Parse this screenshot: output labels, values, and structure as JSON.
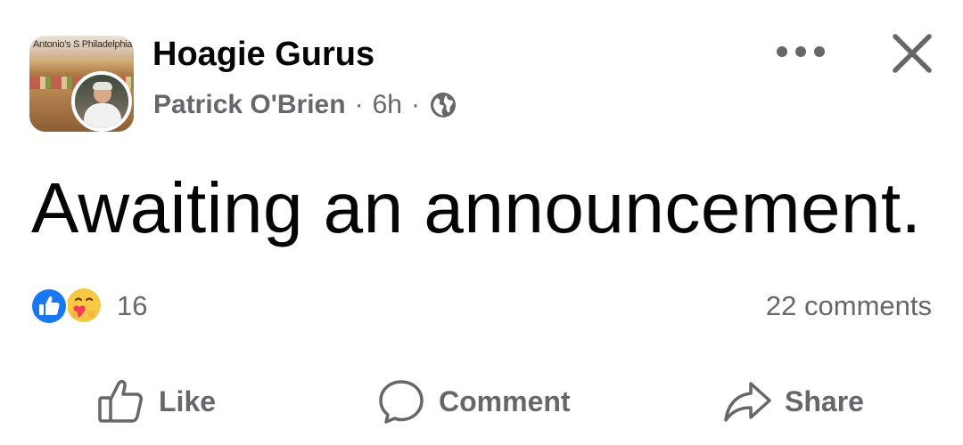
{
  "header": {
    "group_name": "Hoagie Gurus",
    "group_thumb_caption": "Antonio's S Philadelphia",
    "author_name": "Patrick O'Brien",
    "separator": "·",
    "time_ago": "6h",
    "privacy_icon": "globe-icon",
    "more_icon": "more-horizontal-icon",
    "close_icon": "close-icon"
  },
  "post": {
    "text": "Awaiting an announcement."
  },
  "reactions": {
    "icons": [
      "like-reaction-icon",
      "care-reaction-icon"
    ],
    "count": "16",
    "comments": "22 comments"
  },
  "actions": {
    "like_label": "Like",
    "comment_label": "Comment",
    "share_label": "Share"
  },
  "colors": {
    "primary_text": "#050505",
    "secondary_text": "#65676b",
    "like_blue": "#1877f2",
    "care_yellow": "#f7c844",
    "care_heart": "#f33e58"
  }
}
